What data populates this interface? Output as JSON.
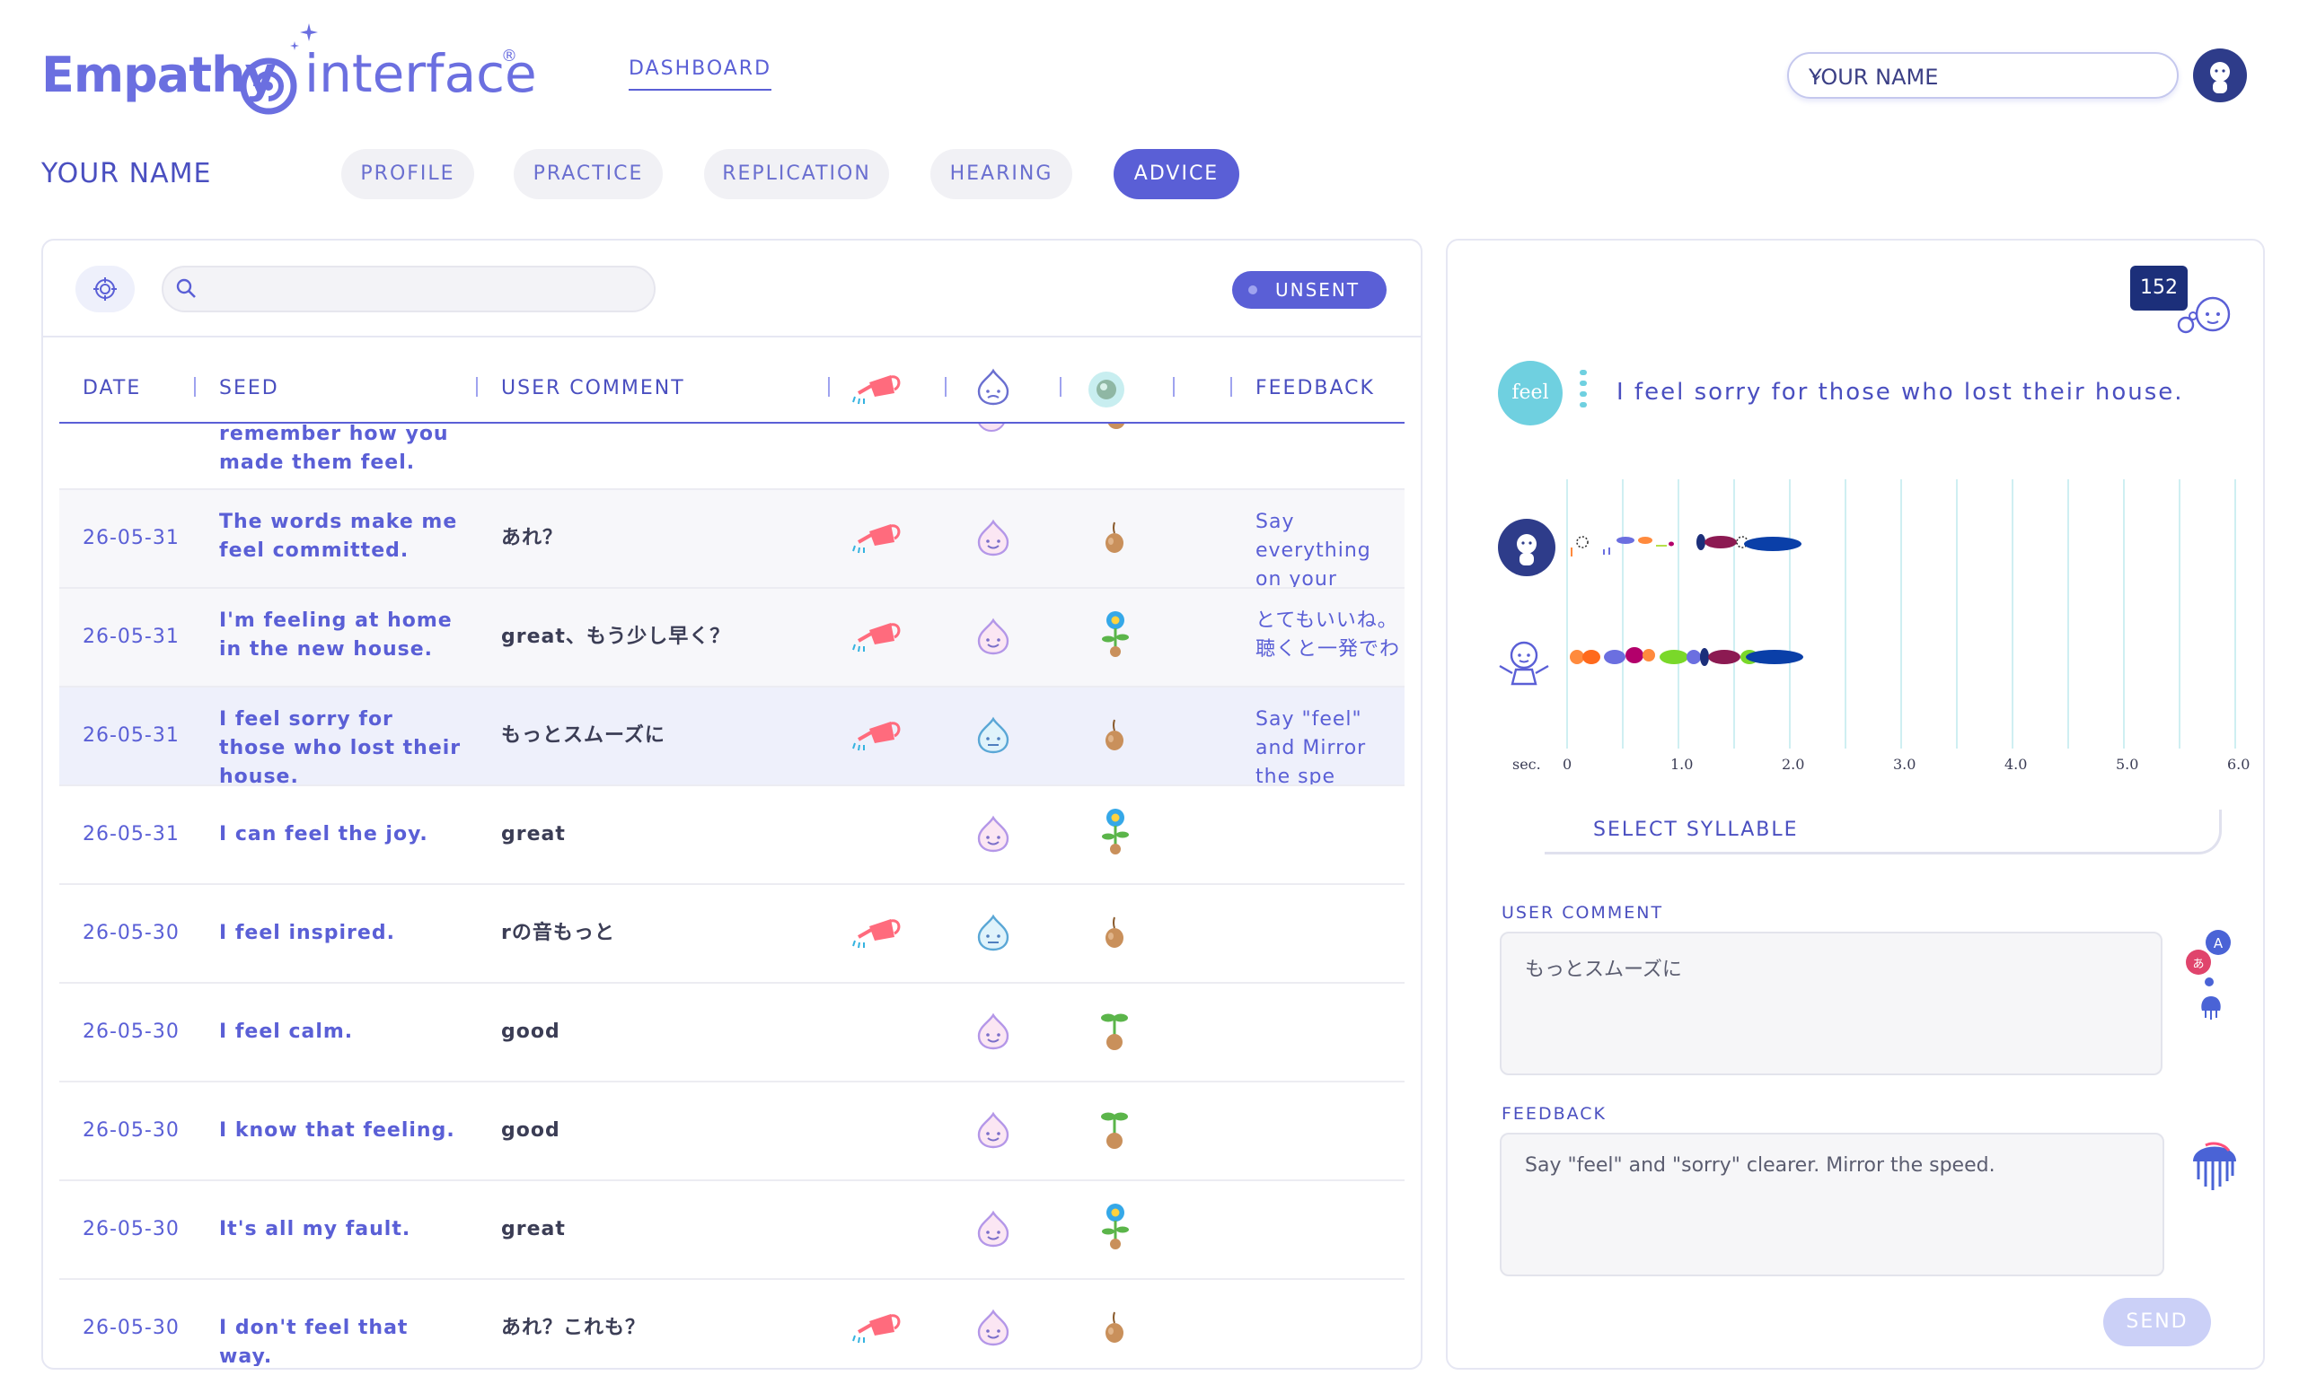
{
  "header": {
    "logo_word1": "Empathy",
    "logo_word2": "interface",
    "logo_reg": "®",
    "nav_dashboard": "DASHBOARD",
    "user_select": "YOUR NAME"
  },
  "section": {
    "name": "YOUR NAME",
    "tabs": [
      {
        "label": "PROFILE",
        "active": false
      },
      {
        "label": "PRACTICE",
        "active": false
      },
      {
        "label": "REPLICATION",
        "active": false
      },
      {
        "label": "HEARING",
        "active": false
      },
      {
        "label": "ADVICE",
        "active": true
      }
    ]
  },
  "toolbar": {
    "search_placeholder": "",
    "unsent_label": "UNSENT"
  },
  "table": {
    "columns": [
      "DATE",
      "SEED",
      "USER COMMENT",
      "FEEDBACK"
    ],
    "partial_row": {
      "seed": "remember how you made them feel."
    },
    "rows": [
      {
        "date": "26-05-31",
        "seed": "The words make me feel committed.",
        "comment": "あれ？",
        "watering": true,
        "mood": "pink-smile",
        "plant": "bulb",
        "feedback": "Say everything on your pronu"
      },
      {
        "date": "26-05-31",
        "seed": "I'm feeling at home in the new house.",
        "comment": "great、もう少し早く？",
        "watering": true,
        "mood": "pink-smile",
        "plant": "flower",
        "feedback": "とてもいいね。 聴くと一発でわ"
      },
      {
        "date": "26-05-31",
        "seed": "I feel sorry for those who lost their house.",
        "comment": "もっとスムーズに",
        "watering": true,
        "mood": "blue-neutral",
        "plant": "bulb",
        "feedback": "Say \"feel\" and Mirror the spe"
      },
      {
        "date": "26-05-31",
        "seed": "I can feel the joy.",
        "comment": "great",
        "watering": false,
        "mood": "pink-smile",
        "plant": "flower",
        "feedback": ""
      },
      {
        "date": "26-05-30",
        "seed": "I feel inspired.",
        "comment": "rの音もっと",
        "watering": true,
        "mood": "blue-neutral",
        "plant": "bulb",
        "feedback": ""
      },
      {
        "date": "26-05-30",
        "seed": "I feel calm.",
        "comment": "good",
        "watering": false,
        "mood": "pink-smile",
        "plant": "sprout",
        "feedback": ""
      },
      {
        "date": "26-05-30",
        "seed": "I know that feeling.",
        "comment": "good",
        "watering": false,
        "mood": "pink-smile",
        "plant": "sprout",
        "feedback": ""
      },
      {
        "date": "26-05-30",
        "seed": "It's all my fault.",
        "comment": "great",
        "watering": false,
        "mood": "pink-smile",
        "plant": "flower",
        "feedback": ""
      },
      {
        "date": "26-05-30",
        "seed": "I don't feel that way.",
        "comment": "あれ？これも？",
        "watering": true,
        "mood": "pink-smile",
        "plant": "bulb",
        "feedback": ""
      }
    ]
  },
  "detail": {
    "count": "152",
    "feel_label": "feel",
    "sentence": "I feel sorry for those who lost their house.",
    "axis_unit": "sec.",
    "ticks": [
      "0",
      "1.0",
      "2.0",
      "3.0",
      "4.0",
      "5.0",
      "6.0"
    ],
    "select_syllable": "SELECT SYLLABLE",
    "user_comment_label": "USER COMMENT",
    "user_comment": "もっとスムーズに",
    "feedback_label": "FEEDBACK",
    "feedback": "Say \"feel\" and \"sorry\" clearer. Mirror the speed.",
    "send_label": "SEND"
  },
  "colors": {
    "accent": "#5a5fd6",
    "badge_dark": "#1c2f7a",
    "feel_badge": "#6fd0e0"
  }
}
